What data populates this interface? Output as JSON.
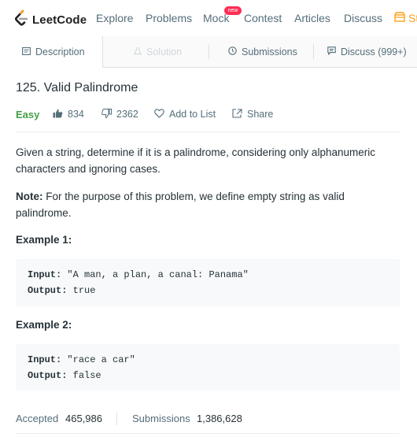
{
  "nav": {
    "brand": "LeetCode",
    "links": [
      "Explore",
      "Problems",
      "Mock",
      "Contest",
      "Articles",
      "Discuss"
    ],
    "new_badge": "new",
    "store_partial": "St",
    "accent_color": "#ffa116"
  },
  "tabs": [
    {
      "label": "Description",
      "icon": "description-icon",
      "state": "active"
    },
    {
      "label": "Solution",
      "icon": "flask-icon",
      "state": "disabled"
    },
    {
      "label": "Submissions",
      "icon": "clock-icon",
      "state": "normal"
    },
    {
      "label": "Discuss (999+)",
      "icon": "comment-icon",
      "state": "normal"
    }
  ],
  "problem": {
    "title": "125. Valid Palindrome",
    "difficulty": "Easy",
    "difficulty_color": "#43a047",
    "likes": "834",
    "dislikes": "2362",
    "add_to_list": "Add to List",
    "share": "Share",
    "description": "Given a string, determine if it is a palindrome, considering only alphanumeric characters and ignoring cases.",
    "note_label": "Note:",
    "note_text": " For the purpose of this problem, we define empty string as valid palindrome.",
    "examples": [
      {
        "heading": "Example 1:",
        "input_label": "Input:",
        "input": " \"A man, a plan, a canal: Panama\"",
        "output_label": "Output:",
        "output": " true"
      },
      {
        "heading": "Example 2:",
        "input_label": "Input:",
        "input": " \"race a car\"",
        "output_label": "Output:",
        "output": " false"
      }
    ]
  },
  "stats": {
    "accepted_label": "Accepted",
    "accepted_value": "465,986",
    "submissions_label": "Submissions",
    "submissions_value": "1,386,628"
  }
}
